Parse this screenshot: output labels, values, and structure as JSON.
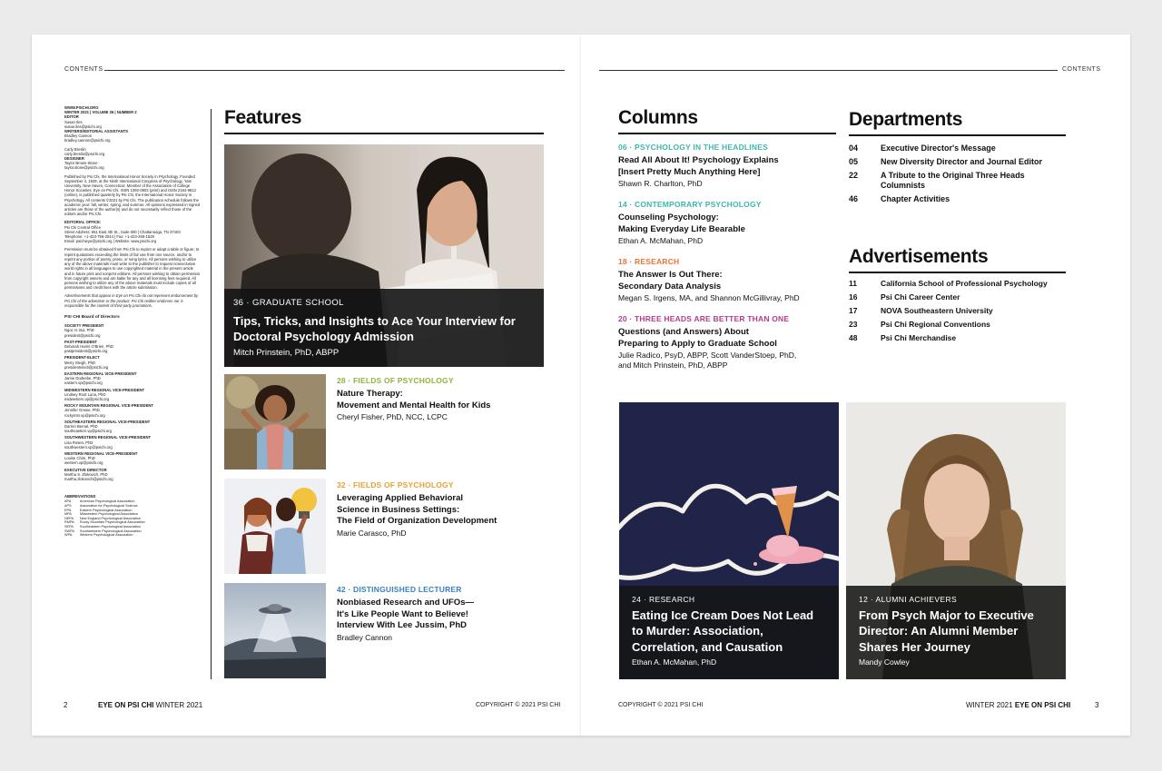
{
  "left_page": {
    "runner": "CONTENTS",
    "page_number": "2",
    "publication": "EYE ON PSI CHI",
    "issue": "WINTER 2021",
    "copyright": "COPYRIGHT © 2021 PSI CHI"
  },
  "right_page": {
    "runner": "CONTENTS",
    "page_number": "3",
    "publication": "EYE ON PSI CHI",
    "issue": "WINTER 2021",
    "copyright": "COPYRIGHT © 2021 PSI CHI"
  },
  "masthead": {
    "site": "WWW.PSICHI.ORG",
    "issue_line": "WINTER 2021 | VOLUME 26 | NUMBER 2",
    "editor_head": "EDITOR",
    "editor": "Susan Iles",
    "editor_email": "susan.iles@psichi.org",
    "assistants_head": "WRITERS/EDITORIAL ASSISTANTS",
    "assistant1": "Bradley Cannon",
    "assistant1_email": "bradley.cannon@psichi.org",
    "assistant2": "Carly Breslin",
    "assistant2_email": "carly.breslin@psichi.org",
    "designer_head": "DESIGNER",
    "designer": "Taylor Brown-Stone",
    "designer_email": "taylor.stone@psichi.org",
    "about": "Published by Psi Chi, the International Honor Society in Psychology. Founded September 4, 1929, at the Ninth International Congress of Psychology, Yale University, New Haven, Connecticut. Member of the Association of College Honor Societies. Eye on Psi Chi, ISSN 1092-0803 (print) and ISSN 2164-9812 (online), is published quarterly by Psi Chi, the International Honor Society in Psychology. All contents ©2021 by Psi Chi. The publication schedule follows the academic year: fall, winter, spring, and summer. All opinions expressed in signed articles are those of the author(s) and do not necessarily reflect those of the editors and/or Psi Chi.",
    "office_head": "EDITORIAL OFFICE:",
    "office": "Psi Chi Central Office",
    "address": "Street Address: 651 East 4th St., Suite 600 | Chattanooga, TN 37403",
    "phone": "Telephone: +1-423-756-2044 | Fax: +1-423-265-1529",
    "web": "Email: psichieye@psichi.org | Website: www.psichi.org",
    "permission": "Permission must be obtained from Psi Chi to reprint or adapt a table or figure; to reprint quotations exceeding the limits of fair use from one source, and/or to reprint any portion of poetry, prose, or song lyrics. All persons wishing to utilize any of the above materials must write to the publisher to request nonexclusive world rights in all languages to use copyrighted material in the present article and in future print and nonprint editions. All persons wishing to obtain permission from copyright owners and are liable for any and all licensing fees required. All persons wishing to utilize any of the above materials must include copies of all permissions and credit lines with the article submission.",
    "ads_note": "Advertisements that appear in Eye on Psi Chi do not represent endorsement by Psi Chi of the advertiser or the product. Psi Chi neither endorses nor is responsible for the content of third-party promotions.",
    "board_head": "PSI CHI Board of Directors",
    "board": [
      {
        "role": "SOCIETY PRESIDENT",
        "name": "Ngoc H. Bui, PhD",
        "email": "president@psichi.org"
      },
      {
        "role": "PAST-PRESIDENT",
        "name": "Deborah Harris O'Brien, PhD",
        "email": "pastpresident@psichi.org"
      },
      {
        "role": "PRESIDENT-ELECT",
        "name": "Merry Sleigh, PhD",
        "email": "presidentelect@psichi.org"
      },
      {
        "role": "EASTERN REGIONAL VICE-PRESIDENT",
        "name": "Jamie Dodeebe, PhD",
        "email": "eastern.vp@psichi.org"
      },
      {
        "role": "MIDWESTERN REGIONAL VICE-PRESIDENT",
        "name": "Lindsey Root Luna, PhD",
        "email": "midwestern.vp@psichi.org"
      },
      {
        "role": "ROCKY MOUNTAIN REGIONAL VICE-PRESIDENT",
        "name": "Jennifer Grewe, PhD",
        "email": "rockymtn.vp@psichi.org"
      },
      {
        "role": "SOUTHEASTERN REGIONAL VICE-PRESIDENT",
        "name": "Darren Bernal, PhD",
        "email": "southeastern.vp@psichi.org"
      },
      {
        "role": "SOUTHWESTERN REGIONAL VICE-PRESIDENT",
        "name": "Lisa Rosen, PhD",
        "email": "southwestern.vp@psichi.org"
      },
      {
        "role": "WESTERN REGIONAL VICE-PRESIDENT",
        "name": "Louise Chim, PhD",
        "email": "western.vp@psichi.org"
      },
      {
        "role": "EXECUTIVE DIRECTOR",
        "name": "Martha S. Zlokovich, PhD",
        "email": "martha.zlokovich@psichi.org"
      }
    ],
    "abbr_head": "ABBREVIATIONS",
    "abbreviations": [
      [
        "APA",
        "American Psychological Association"
      ],
      [
        "APS",
        "Association for Psychological Science"
      ],
      [
        "EPA",
        "Eastern Psychological Association"
      ],
      [
        "MPA",
        "Midwestern Psychological Association"
      ],
      [
        "NEPA",
        "New England Psychological Association"
      ],
      [
        "RMPA",
        "Rocky Mountain Psychological Association"
      ],
      [
        "SEPA",
        "Southeastern Psychological Association"
      ],
      [
        "SWPA",
        "Southwestern Psychological Association"
      ],
      [
        "WPA",
        "Western Psychological Association"
      ]
    ]
  },
  "features": {
    "heading": "Features",
    "lead": {
      "kicker": "36 · GRADUATE SCHOOL",
      "title": "Tips, Tricks, and Insights to Ace Your Interview for Doctoral Psychology Admission",
      "author": "Mitch Prinstein, PhD, ABPP"
    },
    "items": [
      {
        "kicker": "28 · FIELDS OF PSYCHOLOGY",
        "title_lines": [
          "Nature Therapy:",
          "Movement and Mental Health for Kids"
        ],
        "author_lines": [
          "Cheryl Fisher, PhD, NCC, LCPC"
        ]
      },
      {
        "kicker": "32 · FIELDS OF PSYCHOLOGY",
        "title_lines": [
          "Leveraging Applied Behavioral",
          "Science in Business Settings:",
          "The Field of Organization Development"
        ],
        "author_lines": [
          "Marie Carasco, PhD"
        ]
      },
      {
        "kicker": "42 · DISTINGUISHED LECTURER",
        "title_lines": [
          "Nonbiased Research and UFOs—",
          "It's Like People Want to Believe!",
          "Interview With Lee Jussim, PhD"
        ],
        "author_lines": [
          "Bradley Cannon"
        ]
      }
    ]
  },
  "columns": {
    "heading": "Columns",
    "items": [
      {
        "kicker": "06 · PSYCHOLOGY IN THE HEADLINES",
        "color": "#3bb8ad",
        "title_lines": [
          "Read All About It! Psychology Explains",
          "[Insert Pretty Much Anything Here]"
        ],
        "author_lines": [
          "Shawn R. Charlton, PhD"
        ]
      },
      {
        "kicker": "14 · CONTEMPORARY PSYCHOLOGY",
        "color": "#3bb8ad",
        "title_lines": [
          "Counseling Psychology:",
          "Making Everyday Life Bearable"
        ],
        "author_lines": [
          "Ethan A. McMahan, PhD"
        ]
      },
      {
        "kicker": "18 · RESEARCH",
        "color": "#e8733a",
        "title_lines": [
          "The Answer Is Out There:",
          "Secondary Data Analysis"
        ],
        "author_lines": [
          "Megan S. Irgens, MA, and Shannon McGillivray, PhD"
        ]
      },
      {
        "kicker": "20 · THREE HEADS ARE BETTER THAN ONE",
        "color": "#b43c8c",
        "title_lines": [
          "Questions (and Answers) About",
          "Preparing to Apply to Graduate School"
        ],
        "author_lines": [
          "Julie Radico, PsyD, ABPP, Scott VanderStoep, PhD,",
          "and Mitch Prinstein, PhD, ABPP"
        ]
      }
    ]
  },
  "departments": {
    "heading": "Departments",
    "items": [
      {
        "num": "04",
        "title": "Executive Director's Message"
      },
      {
        "num": "05",
        "title": "New Diversity Director and Journal Editor"
      },
      {
        "num": "22",
        "title": "A Tribute to the Original Three Heads Columnists"
      },
      {
        "num": "46",
        "title": "Chapter Activities"
      }
    ]
  },
  "advertisements": {
    "heading": "Advertisements",
    "items": [
      {
        "num": "11",
        "title": "California School of Professional Psychology"
      },
      {
        "num": "16",
        "title": "Psi Chi Career Center"
      },
      {
        "num": "17",
        "title": "NOVA Southeastern University"
      },
      {
        "num": "23",
        "title": "Psi Chi Regional Conventions"
      },
      {
        "num": "48",
        "title": "Psi Chi Merchandise"
      }
    ]
  },
  "promos": [
    {
      "kicker": "24 · RESEARCH",
      "title": "Eating Ice Cream Does Not Lead to Murder: Association, Correlation, and Causation",
      "author": "Ethan A. McMahan, PhD"
    },
    {
      "kicker": "12 · ALUMNI ACHIEVERS",
      "title": "From Psych Major to Executive Director: An Alumni Member Shares Her Journey",
      "author": "Mandy Cowley"
    }
  ],
  "colors": {
    "teal": "#3bb8ad",
    "gold": "#e8a12e",
    "orange": "#e8733a",
    "blue": "#3a7fc1",
    "magenta": "#b43c8c",
    "navy": "#1f2448"
  }
}
